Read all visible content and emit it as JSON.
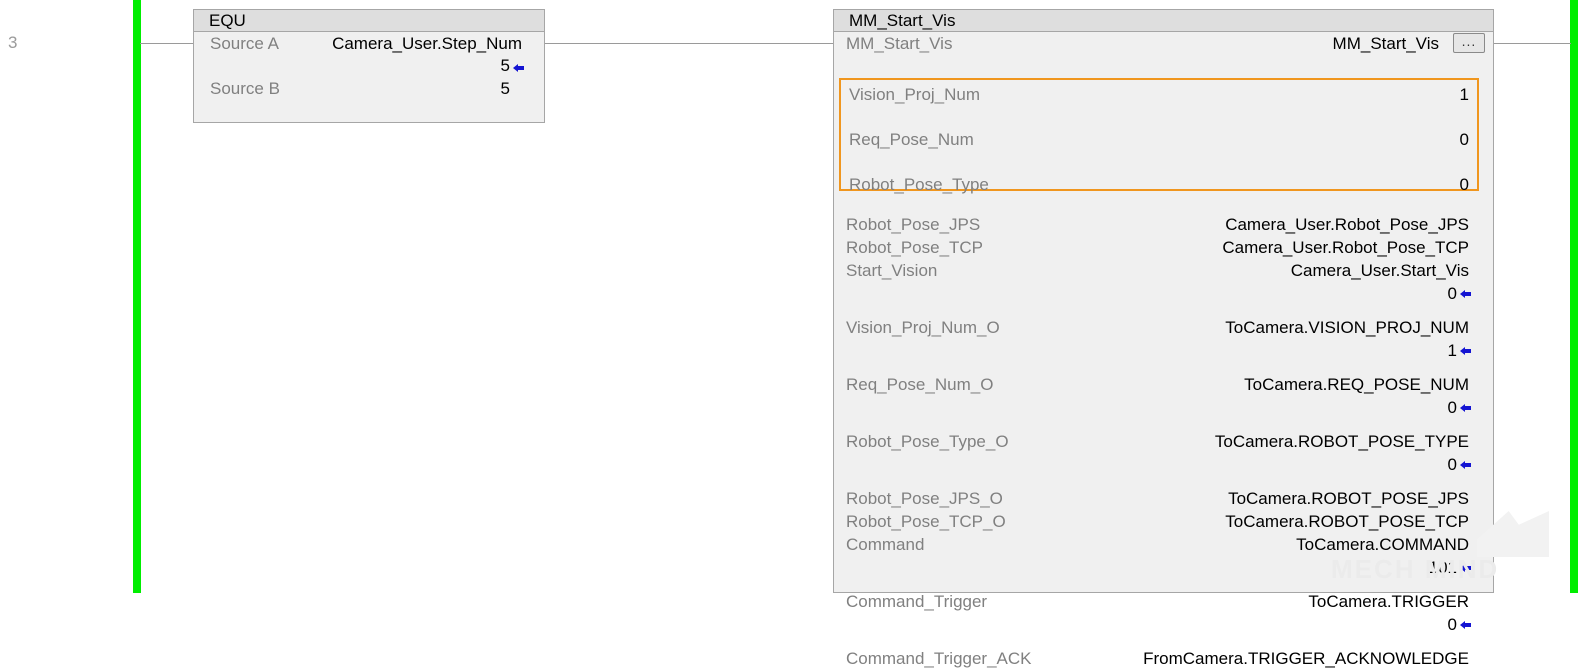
{
  "rung": {
    "number": "3"
  },
  "colors": {
    "rail_green": "#00ee00",
    "selection_orange": "#f0961e",
    "value_marker_blue": "#1414d2",
    "label_gray": "#808080",
    "block_fill": "#f0f0f0",
    "title_fill": "#dedede"
  },
  "equ_block": {
    "title": "EQU",
    "rows": [
      {
        "label": "Source A",
        "operand": "Camera_User.Step_Num",
        "value": "5",
        "has_marker": true
      },
      {
        "label": "Source B",
        "operand": "",
        "value": "5",
        "has_marker": false
      }
    ]
  },
  "mm_block": {
    "title": "MM_Start_Vis",
    "instance": {
      "label": "MM_Start_Vis",
      "value": "MM_Start_Vis",
      "ellipsis_label": "..."
    },
    "selected_rows": [
      {
        "label": "Vision_Proj_Num",
        "value": "1"
      },
      {
        "label": "Req_Pose_Num",
        "value": "0"
      },
      {
        "label": "Robot_Pose_Type",
        "value": "0"
      }
    ],
    "rows": [
      {
        "label": "Robot_Pose_JPS",
        "operand": "Camera_User.Robot_Pose_JPS"
      },
      {
        "label": "Robot_Pose_TCP",
        "operand": "Camera_User.Robot_Pose_TCP"
      },
      {
        "label": "Start_Vision",
        "operand": "Camera_User.Start_Vis"
      },
      {
        "value": "0",
        "has_marker": true
      },
      {
        "label": "Vision_Proj_Num_O",
        "operand": "ToCamera.VISION_PROJ_NUM"
      },
      {
        "value": "1",
        "has_marker": true
      },
      {
        "label": "Req_Pose_Num_O",
        "operand": "ToCamera.REQ_POSE_NUM"
      },
      {
        "value": "0",
        "has_marker": true
      },
      {
        "label": "Robot_Pose_Type_O",
        "operand": "ToCamera.ROBOT_POSE_TYPE"
      },
      {
        "value": "0",
        "has_marker": true
      },
      {
        "label": "Robot_Pose_JPS_O",
        "operand": "ToCamera.ROBOT_POSE_JPS"
      },
      {
        "label": "Robot_Pose_TCP_O",
        "operand": "ToCamera.ROBOT_POSE_TCP"
      },
      {
        "label": "Command",
        "operand": "ToCamera.COMMAND"
      },
      {
        "value": "101",
        "has_marker": true
      },
      {
        "label": "Command_Trigger",
        "operand": "ToCamera.TRIGGER"
      },
      {
        "value": "0",
        "has_marker": true
      },
      {
        "label": "Command_Trigger_ACK",
        "operand": "FromCamera.TRIGGER_ACKNOWLEDGE"
      }
    ]
  },
  "watermark": {
    "text": "MECH MIND"
  }
}
